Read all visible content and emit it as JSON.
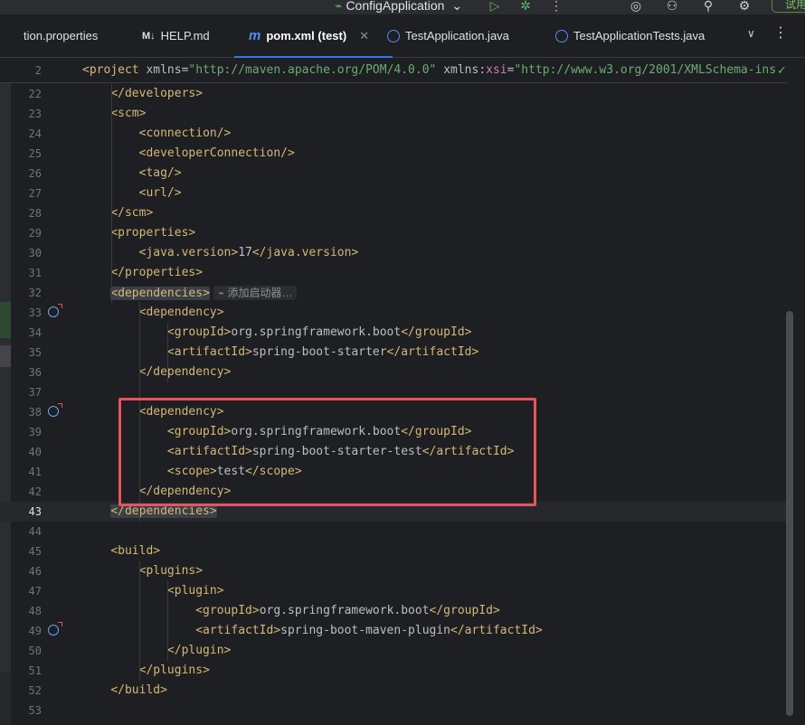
{
  "toolbar": {
    "run_config_label": "ConfigApplication",
    "trial_label": "试用"
  },
  "tabs": [
    {
      "label": "tion.properties",
      "icon": "properties-file-icon"
    },
    {
      "label": "HELP.md",
      "icon": "markdown-icon"
    },
    {
      "label": "pom.xml (test)",
      "icon": "maven-icon",
      "active": true
    },
    {
      "label": "TestApplication.java",
      "icon": "java-class-icon"
    },
    {
      "label": "TestApplicationTests.java",
      "icon": "java-class-icon"
    }
  ],
  "editor": {
    "sticky_line": {
      "number": "2",
      "text": "<project xmlns=\"http://maven.apache.org/POM/4.0.0\" xmlns:xsi=\"http://www.w3.org/2001/XMLSchema-ins"
    },
    "inlay_hint": "添加启动器…",
    "current_line": "43",
    "lines": [
      {
        "n": "22",
        "text": "    </developers>"
      },
      {
        "n": "23",
        "text": "    <scm>"
      },
      {
        "n": "24",
        "text": "        <connection/>"
      },
      {
        "n": "25",
        "text": "        <developerConnection/>"
      },
      {
        "n": "26",
        "text": "        <tag/>"
      },
      {
        "n": "27",
        "text": "        <url/>"
      },
      {
        "n": "28",
        "text": "    </scm>"
      },
      {
        "n": "29",
        "text": "    <properties>"
      },
      {
        "n": "30",
        "text": "        <java.version>17</java.version>"
      },
      {
        "n": "31",
        "text": "    </properties>"
      },
      {
        "n": "32",
        "text": "    <dependencies>"
      },
      {
        "n": "33",
        "text": "        <dependency>",
        "gutter_icon": "spring-bean-icon"
      },
      {
        "n": "34",
        "text": "            <groupId>org.springframework.boot</groupId>"
      },
      {
        "n": "35",
        "text": "            <artifactId>spring-boot-starter</artifactId>"
      },
      {
        "n": "36",
        "text": "        </dependency>"
      },
      {
        "n": "37",
        "text": ""
      },
      {
        "n": "38",
        "text": "        <dependency>",
        "gutter_icon": "spring-bean-icon"
      },
      {
        "n": "39",
        "text": "            <groupId>org.springframework.boot</groupId>"
      },
      {
        "n": "40",
        "text": "            <artifactId>spring-boot-starter-test</artifactId>"
      },
      {
        "n": "41",
        "text": "            <scope>test</scope>"
      },
      {
        "n": "42",
        "text": "        </dependency>"
      },
      {
        "n": "43",
        "text": "    </dependencies>"
      },
      {
        "n": "44",
        "text": ""
      },
      {
        "n": "45",
        "text": "    <build>"
      },
      {
        "n": "46",
        "text": "        <plugins>"
      },
      {
        "n": "47",
        "text": "            <plugin>"
      },
      {
        "n": "48",
        "text": "                <groupId>org.springframework.boot</groupId>"
      },
      {
        "n": "49",
        "text": "                <artifactId>spring-boot-maven-plugin</artifactId>",
        "gutter_icon": "spring-bean-icon"
      },
      {
        "n": "50",
        "text": "            </plugin>"
      },
      {
        "n": "51",
        "text": "        </plugins>"
      },
      {
        "n": "52",
        "text": "    </build>"
      },
      {
        "n": "53",
        "text": ""
      }
    ]
  },
  "annotation": {
    "highlight_color": "#e5545e",
    "highlight_from_line": "38",
    "highlight_to_line": "42"
  }
}
